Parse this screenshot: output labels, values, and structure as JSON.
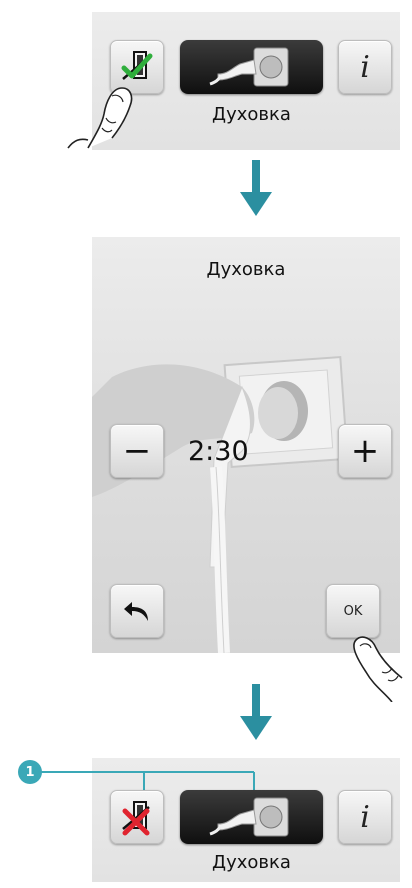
{
  "step1": {
    "device_label": "Духовка",
    "info_label": "i",
    "enabled_mark": "checkmark",
    "colors": {
      "check": "#2fae3c"
    }
  },
  "step2": {
    "title": "Духовка",
    "minus_label": "−",
    "plus_label": "+",
    "time_value": "2:30",
    "ok_label": "OK"
  },
  "step3": {
    "device_label": "Духовка",
    "info_label": "i",
    "disabled_mark": "cross",
    "callout_number": "1",
    "colors": {
      "cross": "#e0242f",
      "callout": "#3aa8b7"
    }
  },
  "colors": {
    "arrow": "#2b8fa0",
    "panel": "#e6e6e6"
  }
}
